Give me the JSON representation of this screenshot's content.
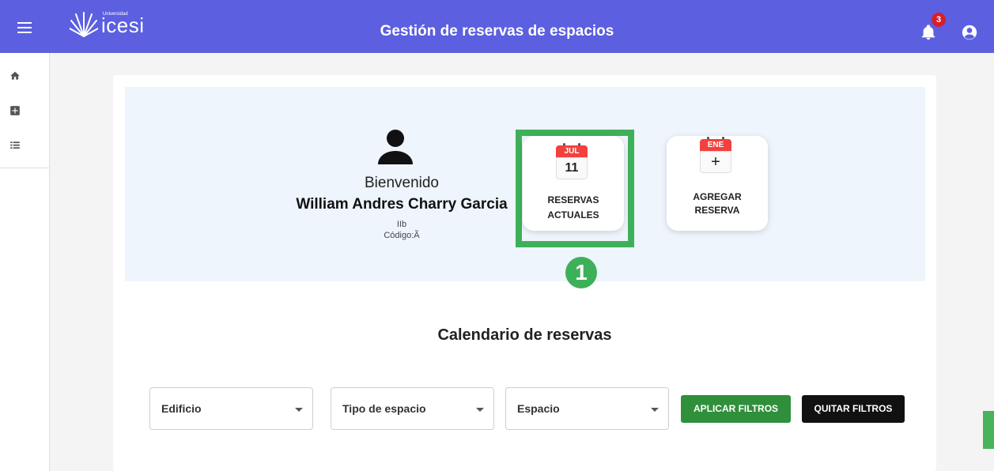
{
  "header": {
    "title": "Gestión de reservas de espacios",
    "logo_small": "Universidad",
    "logo_brand": "icesi",
    "notification_count": "3",
    "accent_color": "#5b5fe0"
  },
  "sidebar": {
    "items": [
      {
        "icon": "home-icon"
      },
      {
        "icon": "add-box-icon"
      },
      {
        "icon": "list-icon"
      }
    ]
  },
  "profile": {
    "greeting": "Bienvenido",
    "name": "William Andres Charry Garcia",
    "id_fragment": "IIb",
    "code_label": "Código:Ã"
  },
  "tiles": {
    "reservations": {
      "month": "JUL",
      "day": "11",
      "line1": "RESERVAS",
      "line2": "ACTUALES"
    },
    "add": {
      "month": "ENE",
      "symbol": "+",
      "line1": "AGREGAR",
      "line2": "RESERVA"
    }
  },
  "step_marker": "1",
  "calendar": {
    "title": "Calendario de reservas",
    "filters": {
      "building": "Edificio",
      "space_type": "Tipo de espacio",
      "space": "Espacio"
    },
    "apply_label": "APLICAR FILTROS",
    "clear_label": "QUITAR FILTROS"
  }
}
